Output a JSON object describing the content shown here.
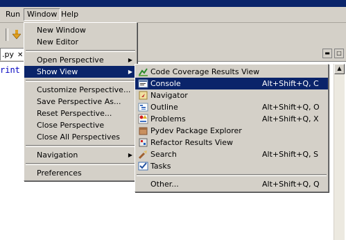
{
  "menubar": {
    "items": [
      "Run",
      "Window",
      "Help"
    ]
  },
  "editor": {
    "tab_file": ".py",
    "tab_close": "✕",
    "code_fragment": "rint"
  },
  "window_menu": {
    "items": [
      {
        "label": "New Window"
      },
      {
        "label": "New Editor"
      },
      {
        "label": "Open Perspective",
        "submenu": true
      },
      {
        "label": "Show View",
        "submenu": true,
        "highlighted": true
      },
      {
        "label": "Customize Perspective..."
      },
      {
        "label": "Save Perspective As..."
      },
      {
        "label": "Reset Perspective..."
      },
      {
        "label": "Close Perspective"
      },
      {
        "label": "Close All Perspectives"
      },
      {
        "label": "Navigation",
        "submenu": true
      },
      {
        "label": "Preferences"
      }
    ]
  },
  "show_view_menu": {
    "items": [
      {
        "label": "Code Coverage Results View",
        "shortcut": "",
        "icon": "code-coverage-icon"
      },
      {
        "label": "Console",
        "shortcut": "Alt+Shift+Q, C",
        "icon": "console-icon",
        "highlighted": true
      },
      {
        "label": "Navigator",
        "shortcut": "",
        "icon": "navigator-icon"
      },
      {
        "label": "Outline",
        "shortcut": "Alt+Shift+Q, O",
        "icon": "outline-icon"
      },
      {
        "label": "Problems",
        "shortcut": "Alt+Shift+Q, X",
        "icon": "problems-icon"
      },
      {
        "label": "Pydev Package Explorer",
        "shortcut": "",
        "icon": "package-explorer-icon"
      },
      {
        "label": "Refactor Results View",
        "shortcut": "",
        "icon": "refactor-icon"
      },
      {
        "label": "Search",
        "shortcut": "Alt+Shift+Q, S",
        "icon": "search-icon"
      },
      {
        "label": "Tasks",
        "shortcut": "",
        "icon": "tasks-icon"
      },
      {
        "label": "Other...",
        "shortcut": "Alt+Shift+Q, Q",
        "icon": ""
      }
    ]
  },
  "colors": {
    "highlight": "#0a246a",
    "menu_bg": "#d4d0c8",
    "title": "#0a246a"
  }
}
